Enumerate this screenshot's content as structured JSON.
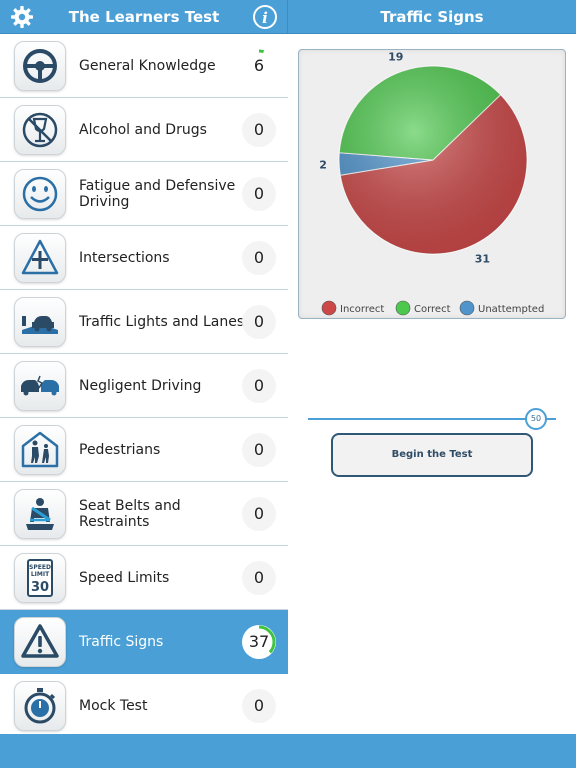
{
  "header": {
    "left_title": "The Learners Test",
    "right_title": "Traffic Signs",
    "settings_icon": "gear-icon",
    "info_icon": "info-icon"
  },
  "categories": [
    {
      "label": "General Knowledge",
      "score": "6",
      "icon": "steering-wheel-icon",
      "progress": 0.05
    },
    {
      "label": "Alcohol and Drugs",
      "score": "0",
      "icon": "no-alcohol-icon"
    },
    {
      "label": "Fatigue and Defensive Driving",
      "score": "0",
      "icon": "smiley-face-icon"
    },
    {
      "label": "Intersections",
      "score": "0",
      "icon": "intersection-sign-icon"
    },
    {
      "label": "Traffic Lights and Lanes",
      "score": "0",
      "icon": "traffic-lanes-icon"
    },
    {
      "label": "Negligent Driving",
      "score": "0",
      "icon": "car-crash-icon"
    },
    {
      "label": "Pedestrians",
      "score": "0",
      "icon": "pedestrian-sign-icon"
    },
    {
      "label": "Seat Belts and Restraints",
      "score": "0",
      "icon": "seat-belt-icon"
    },
    {
      "label": "Speed Limits",
      "score": "0",
      "icon": "speed-limit-sign-icon",
      "sign_top": "SPEED",
      "sign_mid": "LIMIT",
      "sign_value": "30"
    },
    {
      "label": "Traffic Signs",
      "score": "37",
      "icon": "warning-triangle-icon",
      "selected": true,
      "progress": 0.37
    },
    {
      "label": "Mock Test",
      "score": "0",
      "icon": "stopwatch-icon"
    }
  ],
  "chart_data": {
    "type": "pie",
    "slices": [
      {
        "name": "Incorrect",
        "value": 31,
        "color": "#cc4848"
      },
      {
        "name": "Unattempted",
        "value": 2,
        "color": "#4f94cd"
      },
      {
        "name": "Correct",
        "value": 19,
        "color": "#4cc94c"
      }
    ],
    "legend": [
      {
        "name": "Incorrect",
        "color": "#cc4848"
      },
      {
        "name": "Correct",
        "color": "#4cc94c"
      },
      {
        "name": "Unattempted",
        "color": "#4f94cd"
      }
    ],
    "legend_placement": "bottom"
  },
  "slider": {
    "value": "50",
    "fraction": 1.0
  },
  "begin_button": {
    "label": "Begin the Test"
  },
  "colors": {
    "accent": "#4a9fd6",
    "ring_green": "#3ec43e"
  }
}
